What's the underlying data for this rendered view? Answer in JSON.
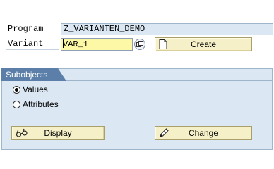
{
  "selection": {
    "program_label": "Program",
    "program_value": "Z_VARIANTEN_DEMO",
    "variant_label": "Variant",
    "variant_value": "VAR_1",
    "create_label": "Create"
  },
  "subobjects": {
    "title": "Subobjects",
    "options": [
      {
        "label": "Values",
        "selected": true
      },
      {
        "label": "Attributes",
        "selected": false
      }
    ]
  },
  "actions": {
    "display_label": "Display",
    "change_label": "Change"
  },
  "icons": {
    "f4": "value-help-icon",
    "create": "new-document-icon",
    "display": "glasses-icon",
    "change": "pencil-icon"
  },
  "colors": {
    "group_bg": "#dbe7f3",
    "group_tab": "#5b7fa8",
    "required_field": "#fdf8a6",
    "button_bg": "#f5f0c8"
  }
}
